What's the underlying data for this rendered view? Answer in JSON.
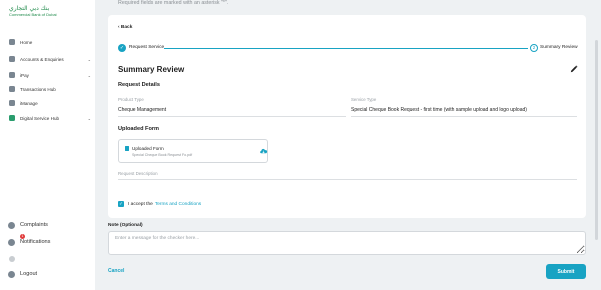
{
  "header": {
    "note": "Required fields are marked with an asterisk \"*\"."
  },
  "brand": {
    "name_ar": "بنك دبي التجاري",
    "name_en": "Commercial Bank of Dubai"
  },
  "sidebar": {
    "items": [
      {
        "label": "Home",
        "has_chevron": false
      },
      {
        "label": "Accounts & Enquiries",
        "has_chevron": true
      },
      {
        "label": "iPay",
        "has_chevron": true
      },
      {
        "label": "Transactions Hub",
        "has_chevron": false
      },
      {
        "label": "iManage",
        "has_chevron": false
      },
      {
        "label": "Digital Service Hub",
        "has_chevron": true
      }
    ],
    "chevron": "⌄",
    "bottom": {
      "complaints": "Complaints",
      "notifications": "Notifications",
      "notifications_badge": "1",
      "logout": "Logout"
    }
  },
  "main": {
    "back": "‹ Back",
    "stepper": {
      "step1": "Request Service",
      "step1_icon": "✓",
      "step2_number": "2",
      "step2": "Summary Review"
    },
    "title": "Summary Review",
    "request_details": {
      "heading": "Request Details",
      "product_type_label": "Product Type",
      "product_type_value": "Cheque Management",
      "service_type_label": "Service Type",
      "service_type_value": "Special Cheque Book Request - first time (with sample upload and logo upload)"
    },
    "uploaded_form": {
      "heading": "Uploaded Form",
      "file_title": "Uploaded Form",
      "file_name": "Special Cheque Book Request Fo.pdf"
    },
    "request_description_label": "Request Description",
    "accept": {
      "check": "✓",
      "text": "I accept the",
      "link": "Terms and Conditions"
    }
  },
  "note": {
    "label": "Note (Optional)",
    "placeholder": "Enter a message for the checker here..."
  },
  "actions": {
    "cancel": "Cancel",
    "submit": "Submit"
  },
  "colors": {
    "accent": "#18a3c3",
    "brand": "#1e8a4a",
    "badge": "#e03a3a"
  }
}
